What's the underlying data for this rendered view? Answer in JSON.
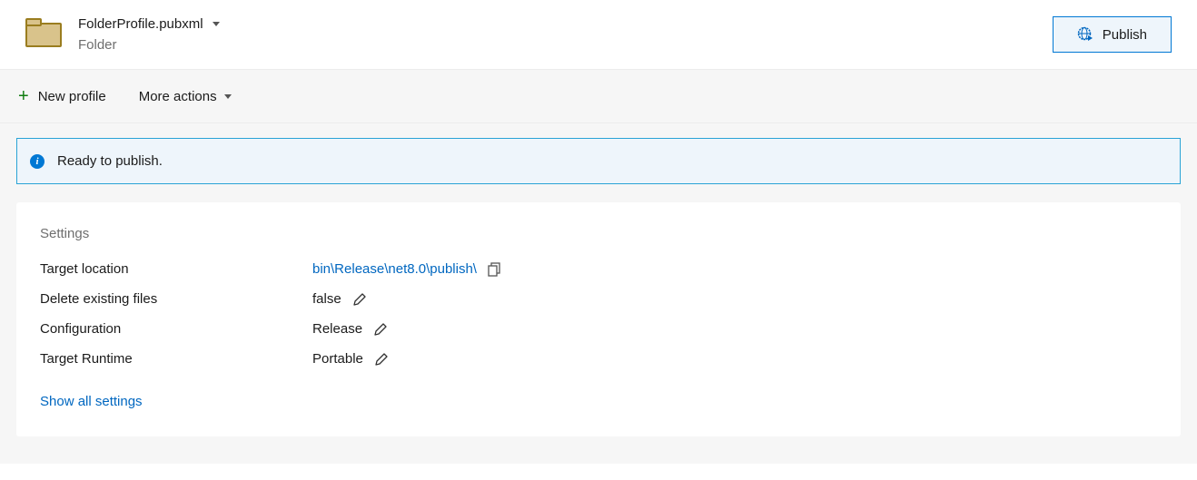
{
  "header": {
    "profile_name": "FolderProfile.pubxml",
    "profile_subtitle": "Folder",
    "publish_label": "Publish"
  },
  "toolbar": {
    "new_profile_label": "New profile",
    "more_actions_label": "More actions"
  },
  "status": {
    "message": "Ready to publish."
  },
  "settings": {
    "section_title": "Settings",
    "rows": {
      "target_location": {
        "label": "Target location",
        "value": "bin\\Release\\net8.0\\publish\\"
      },
      "delete_existing": {
        "label": "Delete existing files",
        "value": "false"
      },
      "configuration": {
        "label": "Configuration",
        "value": "Release"
      },
      "target_runtime": {
        "label": "Target Runtime",
        "value": "Portable"
      }
    },
    "show_all_label": "Show all settings"
  }
}
